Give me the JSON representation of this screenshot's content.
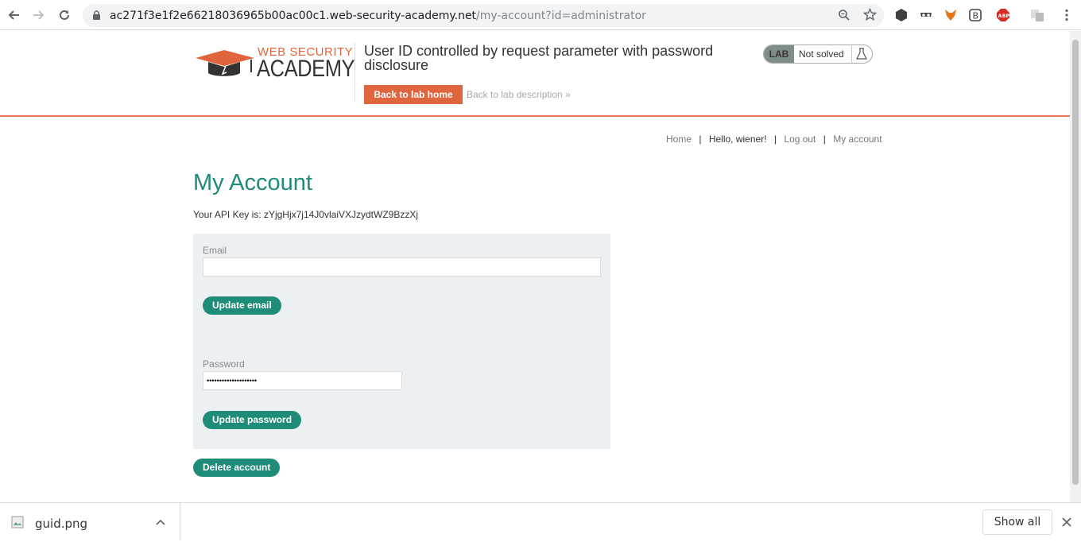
{
  "browser": {
    "url_host": "ac271f3e1f2e66218036965b00ac00c1.web-security-academy.net",
    "url_path": "/my-account?id=administrator"
  },
  "lab_header": {
    "logo_line1": "WEB SECURITY",
    "logo_line2": "ACADEMY",
    "title": "User ID controlled by request parameter with password disclosure",
    "back_home": "Back to lab home",
    "back_description": "Back to lab description",
    "badge_lab": "LAB",
    "badge_status": "Not solved"
  },
  "nav": {
    "home": "Home",
    "greeting": "Hello, wiener!",
    "logout": "Log out",
    "account": "My account",
    "sep": "|"
  },
  "account": {
    "heading": "My Account",
    "api_key_text": "Your API Key is: zYjgHjx7j14J0vlaiVXJzydtWZ9BzzXj",
    "email_label": "Email",
    "email_value": "",
    "update_email": "Update email",
    "password_label": "Password",
    "password_value": "••••••••••••••••••••",
    "update_password": "Update password",
    "delete_account": "Delete account"
  },
  "downloads": {
    "file_name": "guid.png",
    "show_all": "Show all"
  },
  "colors": {
    "accent_orange": "#e0643e",
    "accent_teal": "#1f8c7a"
  }
}
